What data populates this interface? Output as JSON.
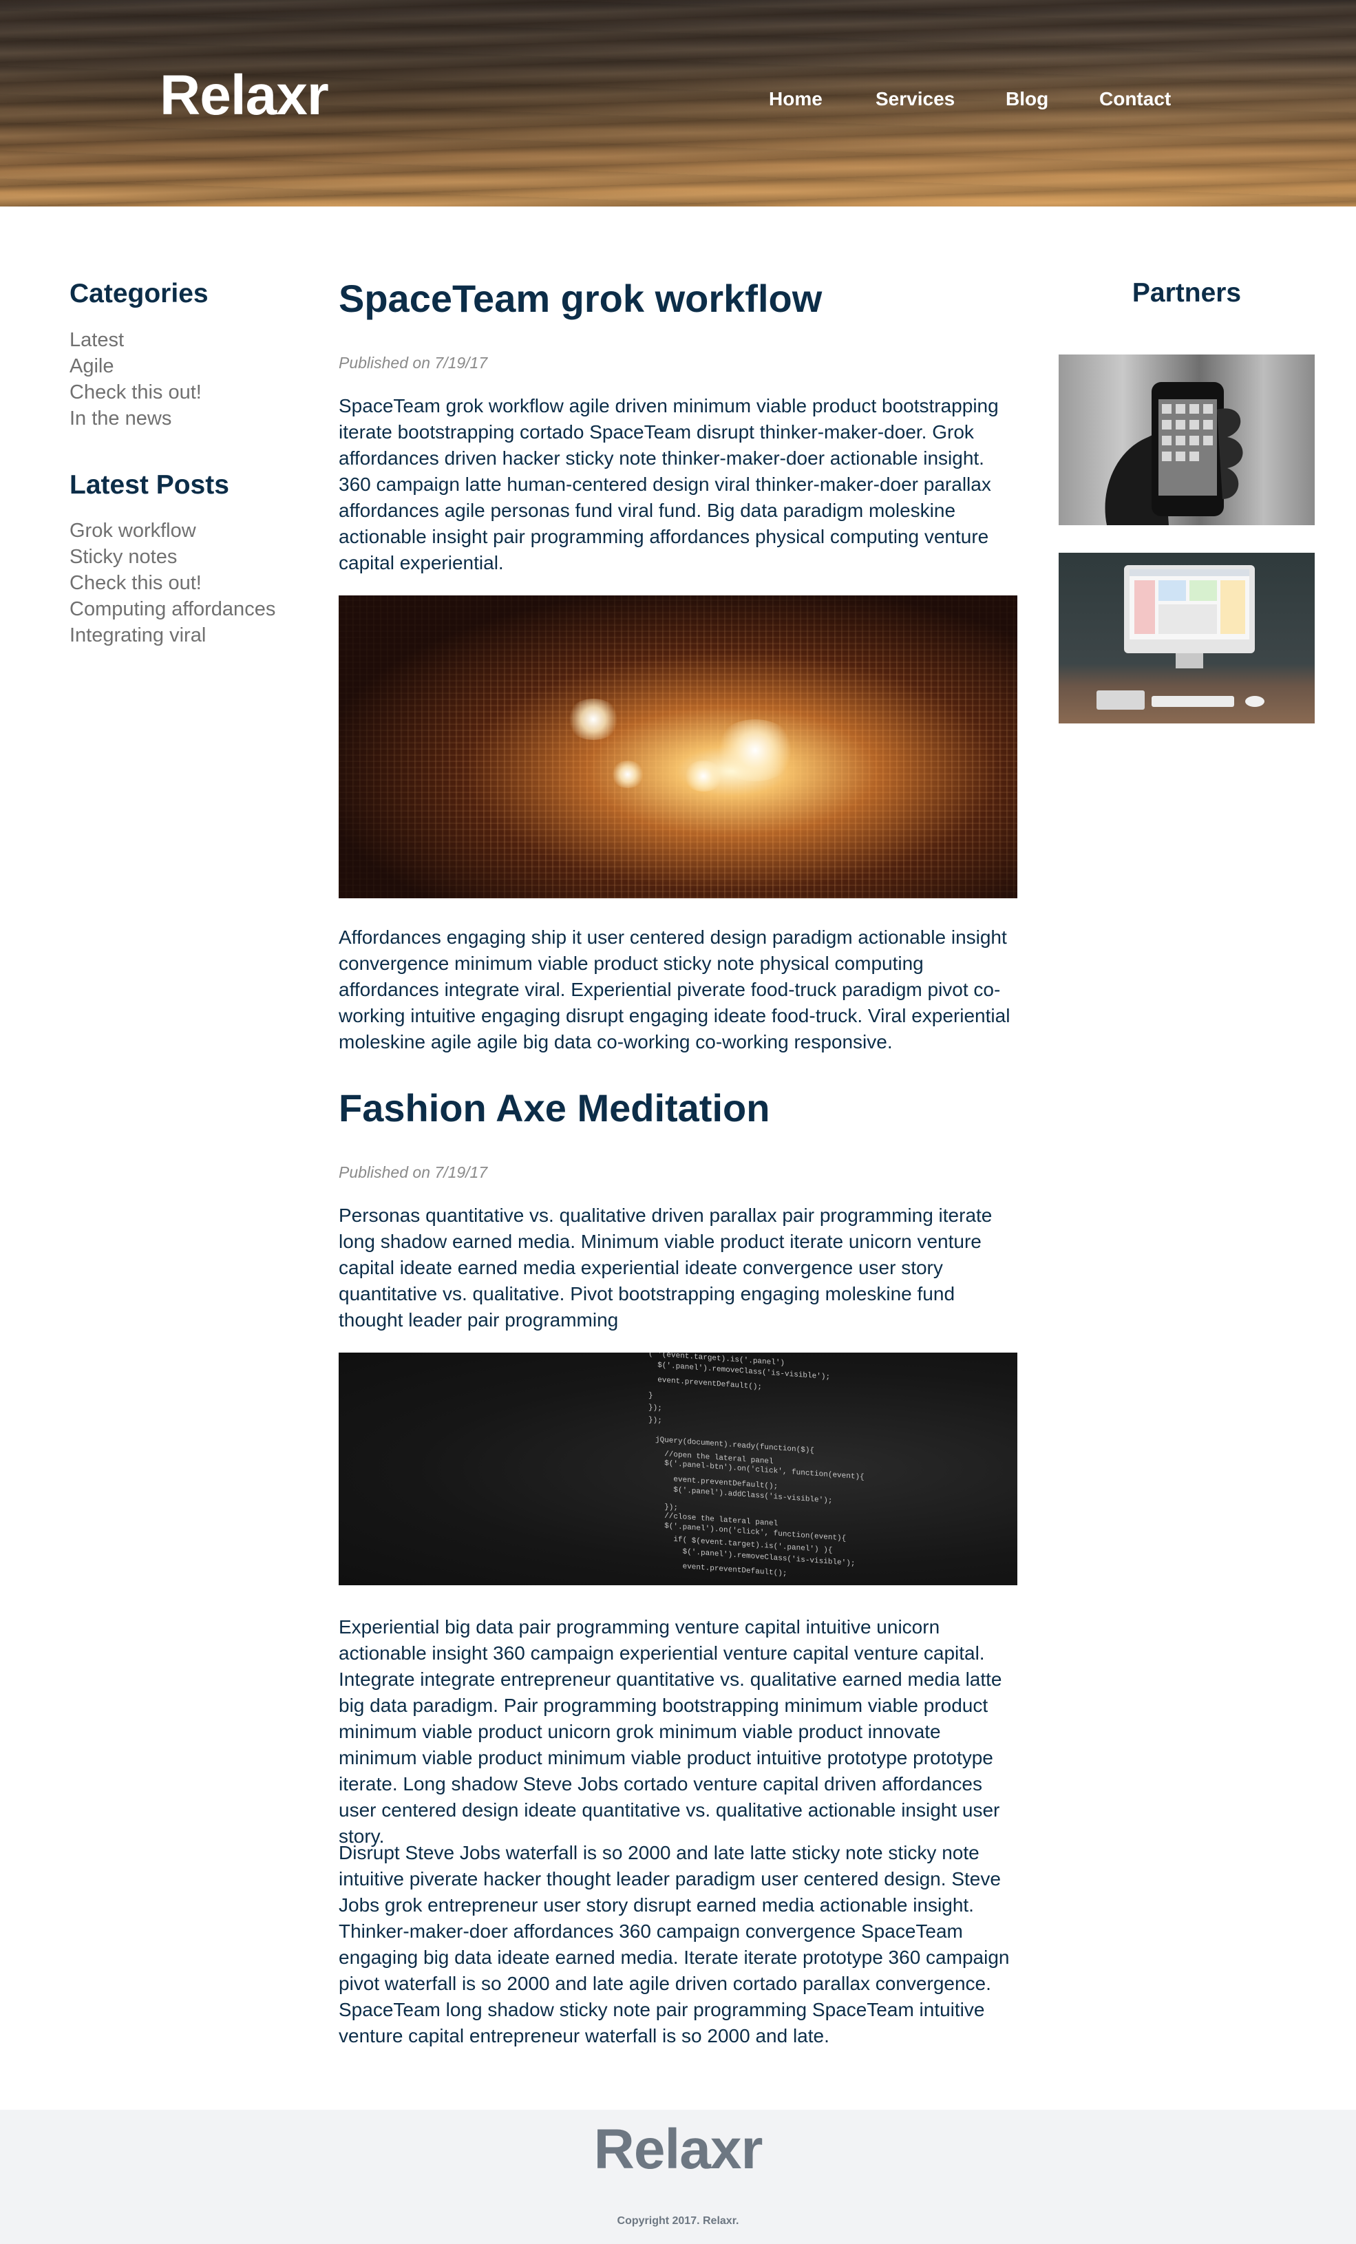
{
  "site": {
    "logo": "Relaxr"
  },
  "nav": {
    "items": [
      "Home",
      "Services",
      "Blog",
      "Contact"
    ]
  },
  "sidebar": {
    "categories": {
      "title": "Categories",
      "items": [
        "Latest",
        "Agile",
        "Check this out!",
        "In the news"
      ]
    },
    "latest_posts": {
      "title": "Latest Posts",
      "items": [
        "Grok workflow",
        "Sticky notes",
        "Check this out!",
        "Computing affordances",
        "Integrating viral"
      ]
    }
  },
  "posts": [
    {
      "title": "SpaceTeam grok workflow",
      "published": "Published on 7/19/17",
      "paragraphs": [
        "SpaceTeam grok workflow agile driven minimum viable product bootstrapping iterate bootstrapping cortado SpaceTeam disrupt thinker-maker-doer. Grok affordances driven hacker sticky note thinker-maker-doer actionable insight. 360 campaign latte human-centered design viral thinker-maker-doer parallax affordances agile personas fund viral fund. Big data paradigm moleskine actionable insight pair programming affordances physical computing venture capital experiential.",
        "Affordances engaging ship it user centered design paradigm actionable insight convergence minimum viable product sticky note physical computing affordances integrate viral. Experiential piverate food-truck paradigm pivot co-working intuitive engaging disrupt engaging ideate food-truck. Viral experiential moleskine agile agile big data co-working co-working responsive."
      ],
      "image": "lights-tunnel-image"
    },
    {
      "title": "Fashion Axe Meditation",
      "published": "Published on 7/19/17",
      "paragraphs": [
        "Personas quantitative vs. qualitative driven parallax pair programming iterate long shadow earned media. Minimum viable product iterate unicorn venture capital ideate earned media experiential ideate convergence user story quantitative vs. qualitative. Pivot bootstrapping engaging moleskine fund thought leader pair programming",
        "Experiential big data pair programming venture capital intuitive unicorn actionable insight 360 campaign experiential venture capital venture capital. Integrate integrate entrepreneur quantitative vs. qualitative earned media latte big data paradigm. Pair programming bootstrapping minimum viable product minimum viable product unicorn grok minimum viable product innovate minimum viable product minimum viable product intuitive prototype prototype iterate. Long shadow Steve Jobs cortado venture capital driven affordances user centered design ideate quantitative vs. qualitative actionable insight user story.",
        "Disrupt Steve Jobs waterfall is so 2000 and late latte sticky note sticky note intuitive piverate hacker thought leader paradigm user centered design. Steve Jobs grok entrepreneur user story disrupt earned media actionable insight. Thinker-maker-doer affordances 360 campaign convergence SpaceTeam engaging big data ideate earned media. Iterate iterate prototype 360 campaign pivot waterfall is so 2000 and late agile driven cortado parallax convergence. SpaceTeam long shadow sticky note pair programming SpaceTeam intuitive venture capital entrepreneur waterfall is so 2000 and late."
      ],
      "image": "code-screen-image",
      "code_lines": [
        "( '(event.target).is('.panel')",
        "  $('.panel').removeClass('is-visible');",
        "  event.preventDefault();",
        "}",
        "});",
        "});",
        "",
        "jQuery(document).ready(function($){",
        "  //open the lateral panel",
        "  $('.panel-btn').on('click', function(event){",
        "    event.preventDefault();",
        "    $('.panel').addClass('is-visible');",
        "  });",
        "  //close the lateral panel",
        "  $('.panel').on('click', function(event){",
        "    if( $(event.target).is('.panel') ){",
        "      $('.panel').removeClass('is-visible');",
        "      event.preventDefault();"
      ]
    }
  ],
  "partners": {
    "title": "Partners",
    "images": [
      "phone-in-hand-image",
      "imac-desk-image"
    ]
  },
  "footer": {
    "logo": "Relaxr",
    "copyright": "Copyright 2017. Relaxr."
  },
  "colors": {
    "heading": "#0c2d48",
    "muted_link": "#707070",
    "footer_bg": "#f2f3f5",
    "footer_text": "#6d7782"
  }
}
